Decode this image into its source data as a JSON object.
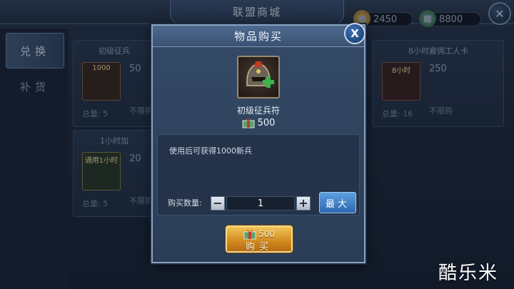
{
  "screen": {
    "title": "联盟商城",
    "currency": [
      {
        "icon": "coin-icon",
        "amount": "2450"
      },
      {
        "icon": "gift-box-icon",
        "amount": "8800"
      }
    ]
  },
  "tabs": [
    {
      "label": "兑换",
      "active": true
    },
    {
      "label": "补货",
      "active": false
    }
  ],
  "shop_cards": [
    {
      "title": "初级征兵",
      "badge": "1000",
      "price": "50",
      "stock": "总量: 5",
      "limit": "不限购"
    },
    {
      "title": "1小时加",
      "badge": "通用1小时",
      "price": "20",
      "stock": "总量: 5",
      "limit": "不限购"
    },
    {
      "title": "8小时雇佣工人卡",
      "badge": "8小时",
      "price": "250",
      "stock": "总量: 16",
      "limit": "不限购"
    }
  ],
  "modal": {
    "title": "物品购买",
    "close_label": "X",
    "item_name": "初级征兵符",
    "item_price": "500",
    "description": "使用后可获得1000新兵",
    "quantity_label": "购买数量:",
    "quantity": "1",
    "minus_label": "−",
    "plus_label": "+",
    "max_label": "最大",
    "buy_price": "500",
    "buy_label": "购买"
  },
  "watermark": "酷乐米",
  "colors": {
    "accent_blue": "#2e67b0",
    "buy_gold": "#d1891f",
    "panel": "#2b3d56"
  }
}
